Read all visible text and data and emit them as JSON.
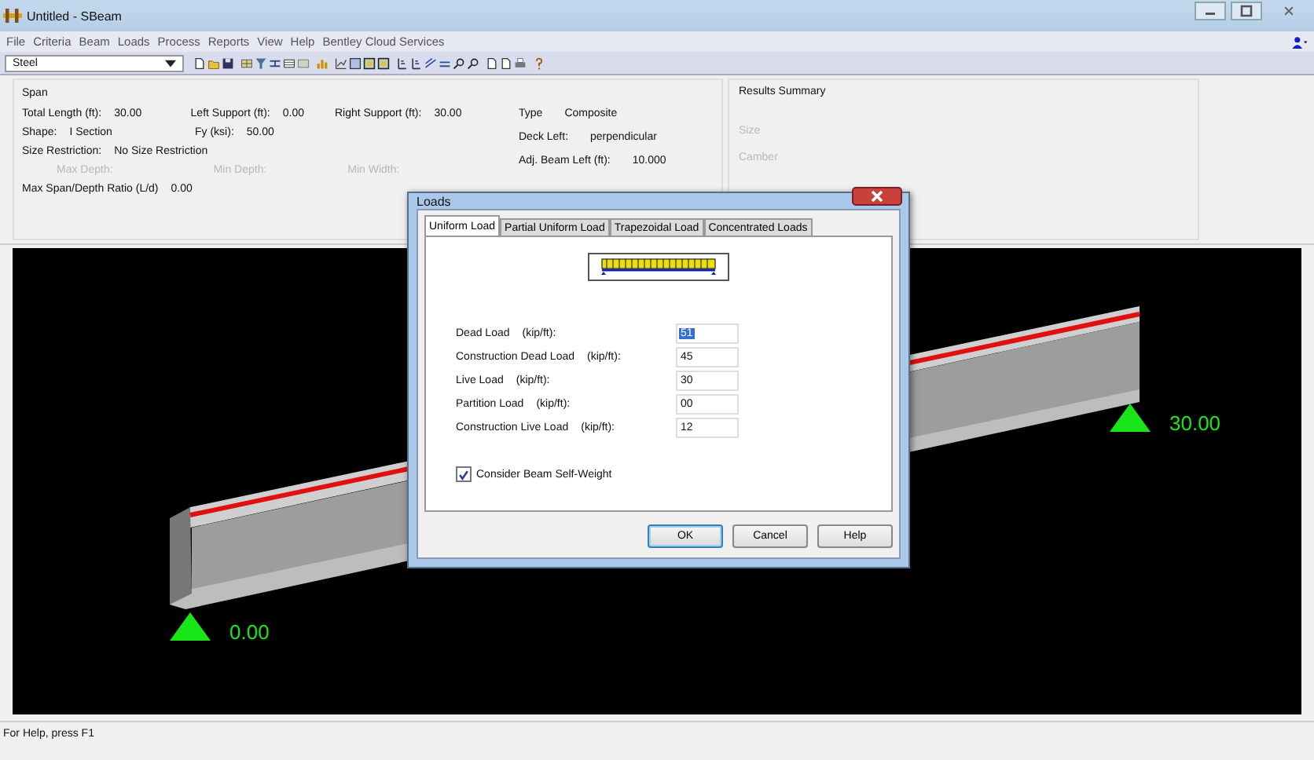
{
  "window": {
    "title": "Untitled - SBeam"
  },
  "menu": [
    "File",
    "Criteria",
    "Beam",
    "Loads",
    "Process",
    "Reports",
    "View",
    "Help",
    "Bentley Cloud Services"
  ],
  "material_select": {
    "value": "Steel"
  },
  "span": {
    "title": "Span",
    "rows": [
      [
        {
          "label": "Total Length (ft):",
          "value": "30.00",
          "disabled": false
        },
        {
          "label": "Left Support (ft):",
          "value": "0.00",
          "disabled": false
        },
        {
          "label": "Right Support (ft):",
          "value": "30.00",
          "disabled": false
        }
      ],
      [
        {
          "label": "Shape:",
          "value": "I Section",
          "disabled": false
        },
        {
          "label": "Fy (ksi):",
          "value": "50.00",
          "disabled": false
        }
      ],
      [
        {
          "label": "Size Restriction:",
          "value": "No Size Restriction",
          "disabled": false
        }
      ],
      [
        {
          "label": "Max Depth:",
          "disabled": true
        },
        {
          "label": "Min Depth:",
          "disabled": true
        },
        {
          "label": "Min Width:",
          "disabled": true
        }
      ],
      [
        {
          "label": "Max Span/Depth Ratio (L/d)",
          "value": "0.00",
          "disabled": false
        }
      ]
    ],
    "composite": [
      {
        "label": "Type",
        "value": "Composite"
      },
      {
        "label": "Deck Left:",
        "value": "perpendicular"
      },
      {
        "label": "Adj. Beam Left (ft):",
        "value": "10.000"
      }
    ]
  },
  "results_summary": {
    "title": "Results Summary",
    "items": [
      {
        "label": "Size",
        "disabled": true
      },
      {
        "label": "Camber",
        "disabled": true
      }
    ]
  },
  "view": {
    "supports": [
      {
        "label": "0.00"
      },
      {
        "label": "30.00"
      }
    ]
  },
  "dialog": {
    "title": "Loads",
    "tabs": [
      {
        "label": "Uniform Load",
        "selected": true
      },
      {
        "label": "Partial Uniform Load",
        "selected": false
      },
      {
        "label": "Trapezoidal Load",
        "selected": false
      },
      {
        "label": "Concentrated Loads",
        "selected": false
      }
    ],
    "loads": [
      {
        "label": "Dead Load",
        "unit": "(kip/ft):",
        "value": "51",
        "selected": true
      },
      {
        "label": "Construction Dead Load",
        "unit": "(kip/ft):",
        "value": "45",
        "selected": false
      },
      {
        "label": "Live Load",
        "unit": "(kip/ft):",
        "value": "30",
        "selected": false
      },
      {
        "label": "Partition Load",
        "unit": "(kip/ft):",
        "value": "00",
        "selected": false
      },
      {
        "label": "Construction Live Load",
        "unit": "(kip/ft):",
        "value": "12",
        "selected": false
      }
    ],
    "self_weight": {
      "label": "Consider Beam Self-Weight",
      "checked": true
    },
    "buttons": [
      {
        "label": "OK",
        "default": true
      },
      {
        "label": "Cancel",
        "default": false
      },
      {
        "label": "Help",
        "default": false
      }
    ]
  },
  "status_bar": {
    "text": "For Help, press F1"
  }
}
